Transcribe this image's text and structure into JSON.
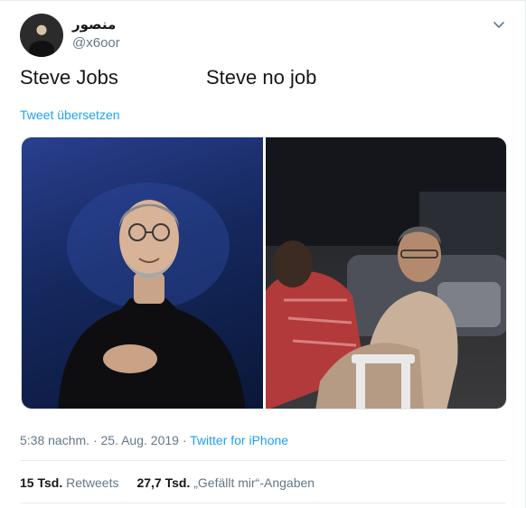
{
  "user": {
    "display_name": "منصور",
    "handle": "@x6oor"
  },
  "tweet": {
    "text_left": "Steve Jobs",
    "text_right": "Steve no job",
    "translate_label": "Tweet übersetzen"
  },
  "meta": {
    "time": "5:38 nachm.",
    "separator": " · ",
    "date": "25. Aug. 2019",
    "source": "Twitter for iPhone"
  },
  "stats": {
    "retweets_count": "15 Tsd.",
    "retweets_label": "Retweets",
    "likes_count": "27,7 Tsd.",
    "likes_label": "„Gefällt mir“-Angaben"
  },
  "colors": {
    "accent": "#1da1f2",
    "text": "#14171a",
    "secondary": "#657786"
  }
}
